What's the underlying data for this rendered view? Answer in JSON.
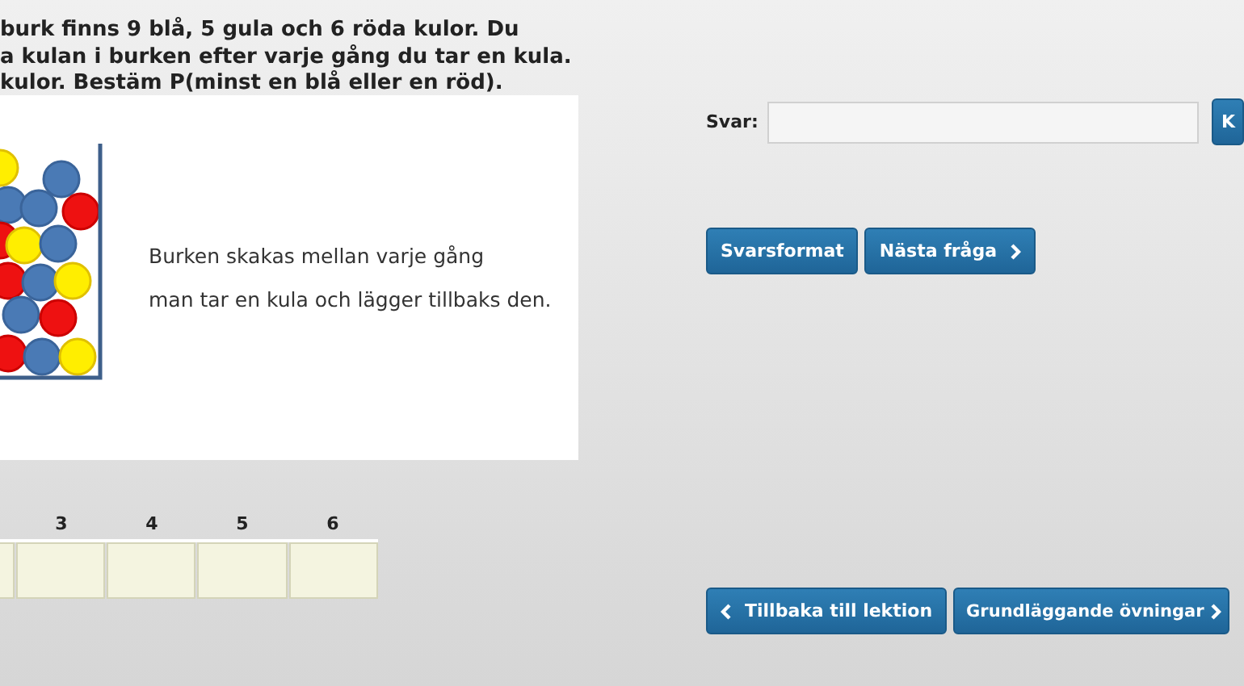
{
  "question": {
    "lines": [
      "burk finns 9 blå, 5 gula och 6 röda kulor. Du",
      "a kulan i burken efter varje gång du tar en kula.",
      "kulor. Bestäm P(minst en blå eller en röd)."
    ]
  },
  "illustration": {
    "caption_lines": [
      "Burken skakas mellan varje gång",
      "man tar en kula och lägger tillbaks den."
    ]
  },
  "steps": {
    "labels": [
      "3",
      "4",
      "5",
      "6"
    ]
  },
  "answer": {
    "label": "Svar:",
    "check_button": "K"
  },
  "buttons": [
    {
      "label": "Svarsformat",
      "kind": "plain"
    },
    {
      "label": "Nästa fråga",
      "kind": "next"
    }
  ],
  "navigation": [
    {
      "label": "Tillbaka till lektion",
      "kind": "back"
    },
    {
      "label": "Grundläggande övningar",
      "kind": "next"
    }
  ]
}
